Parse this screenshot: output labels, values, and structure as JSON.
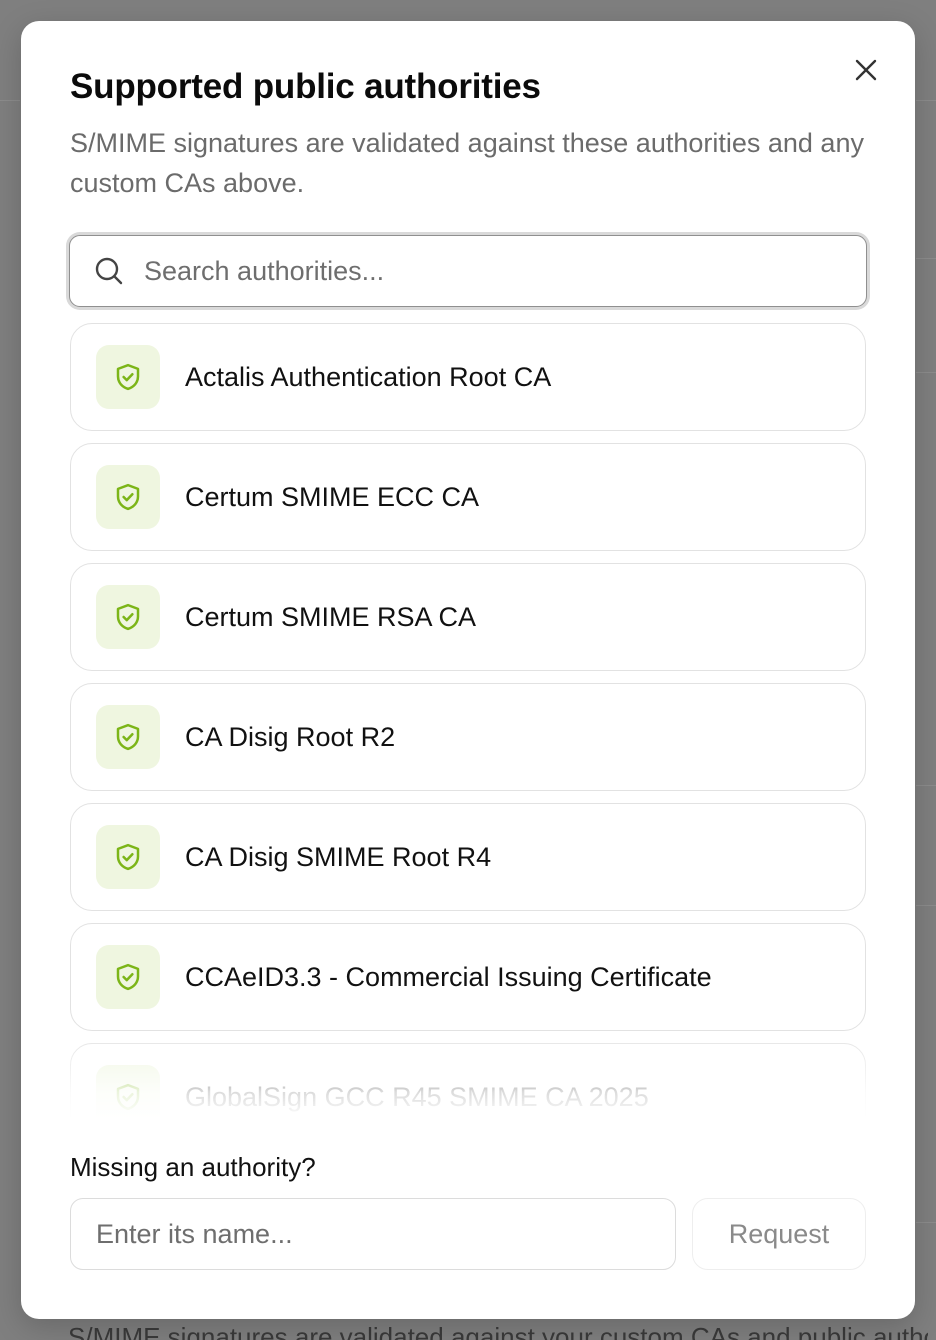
{
  "modal": {
    "title": "Supported public authorities",
    "subtitle": "S/MIME signatures are validated against these authorities and any custom CAs above.",
    "close_icon": "close-icon"
  },
  "search": {
    "placeholder": "Search authorities...",
    "icon": "search-icon"
  },
  "authorities": [
    {
      "label": "Actalis Authentication Root CA",
      "icon": "shield-check-icon"
    },
    {
      "label": "Certum SMIME ECC CA",
      "icon": "shield-check-icon"
    },
    {
      "label": "Certum SMIME RSA CA",
      "icon": "shield-check-icon"
    },
    {
      "label": "CA Disig Root R2",
      "icon": "shield-check-icon"
    },
    {
      "label": "CA Disig SMIME Root R4",
      "icon": "shield-check-icon"
    },
    {
      "label": "CCAeID3.3 - Commercial Issuing Certificate",
      "icon": "shield-check-icon"
    },
    {
      "label": "GlobalSign GCC R45 SMIME CA 2025",
      "icon": "shield-check-icon"
    }
  ],
  "missing": {
    "label": "Missing an authority?",
    "input_placeholder": "Enter its name...",
    "request_label": "Request"
  },
  "background_text": "S/MIME signatures are validated against your custom CAs and public authorities",
  "colors": {
    "accent_green": "#7cb518",
    "icon_bg": "#eff6e0",
    "overlay": "#7f7f7f"
  }
}
